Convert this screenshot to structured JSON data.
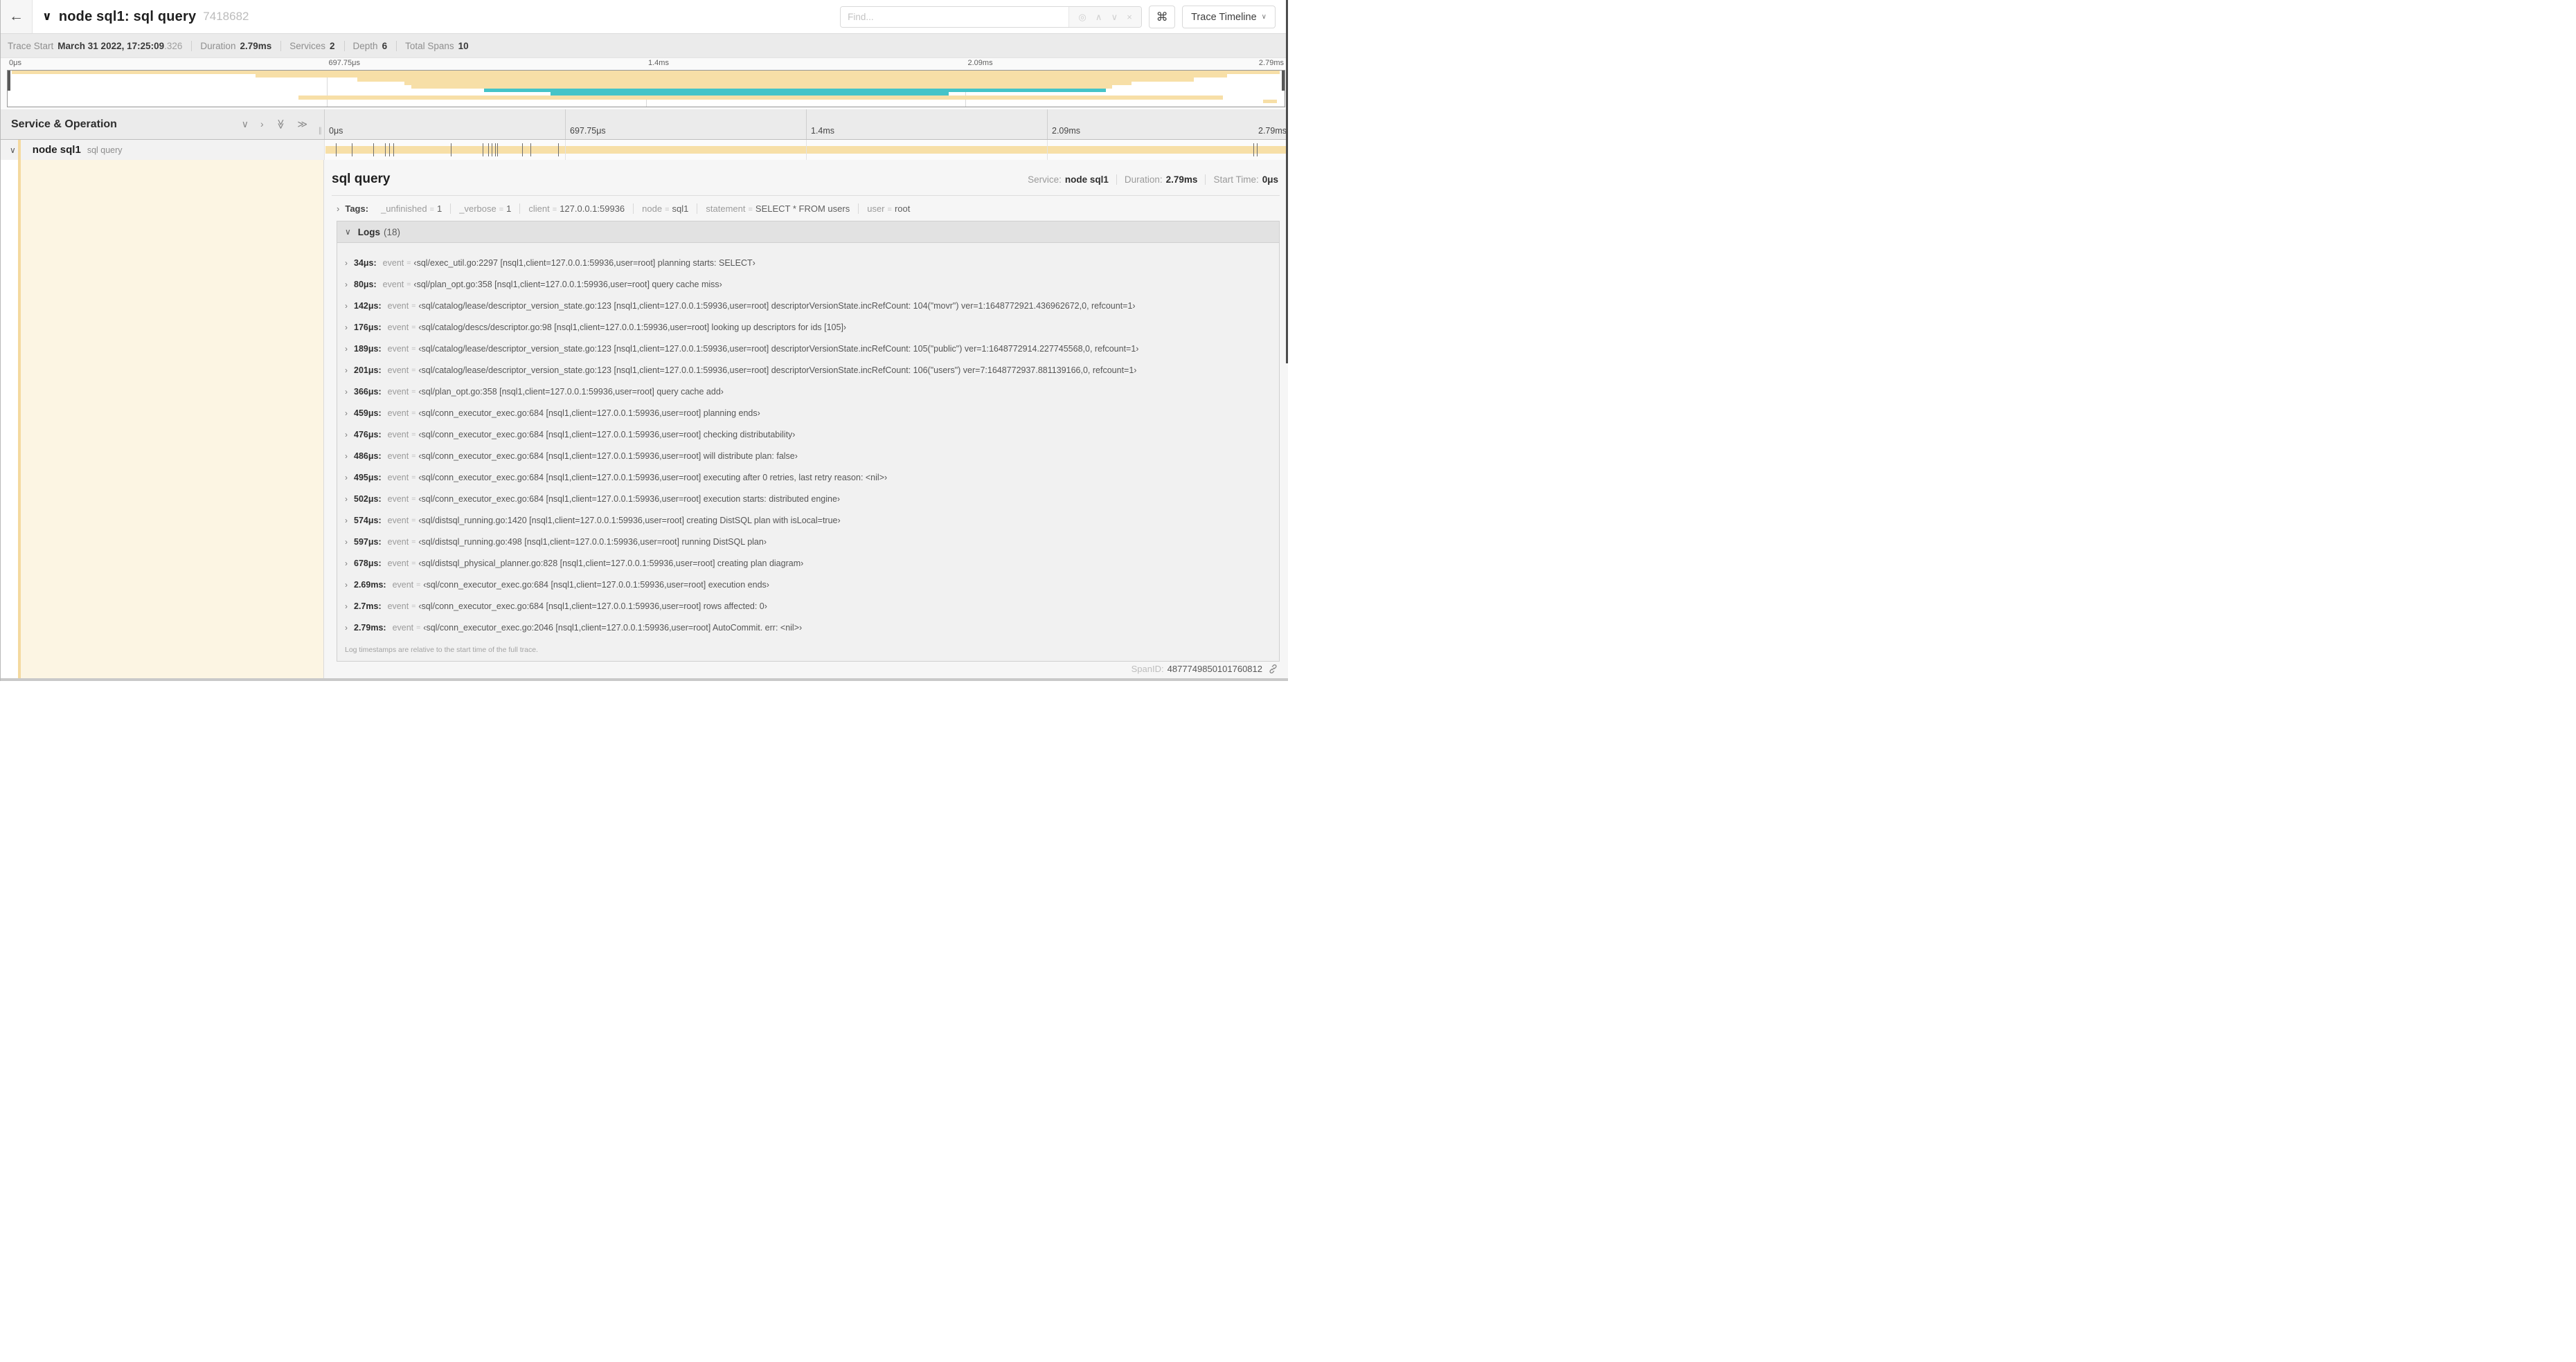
{
  "glyphs": {
    "back": "←",
    "chevron_down": "∨",
    "chevron_right": "›",
    "double_chevron_right": "≫",
    "target": "◎",
    "up": "∧",
    "down": "∨",
    "close": "×",
    "command": "⌘",
    "caret": "›",
    "eq": "=",
    "quote_open": "‹",
    "quote_close": "›",
    "grip": "∥"
  },
  "header": {
    "title": "node sql1: sql query",
    "trace_id": "7418682",
    "find_placeholder": "Find...",
    "shortcut_label": "⌘",
    "view_selector": "Trace Timeline"
  },
  "summary": {
    "items": [
      {
        "label": "Trace Start",
        "value": "March 31 2022, 17:25:09",
        "suffix": ".326"
      },
      {
        "label": "Duration",
        "value": "2.79ms"
      },
      {
        "label": "Services",
        "value": "2"
      },
      {
        "label": "Depth",
        "value": "6"
      },
      {
        "label": "Total Spans",
        "value": "10"
      }
    ]
  },
  "timeline": {
    "duration_us": 2790,
    "tick_labels": [
      "0μs",
      "697.75μs",
      "1.4ms",
      "2.09ms",
      "2.79ms"
    ],
    "tick_positions": [
      0,
      25,
      50,
      75,
      100
    ],
    "minimap_grid_positions": [
      25,
      50,
      75
    ],
    "main_grid_positions": [
      0,
      25,
      50,
      75
    ]
  },
  "minimap": {
    "rows": 10,
    "spans": [
      {
        "row": 0,
        "start_pct": 0.3,
        "end_pct": 99.6,
        "color": "tan"
      },
      {
        "row": 1,
        "start_pct": 19.4,
        "end_pct": 95.5,
        "color": "tan"
      },
      {
        "row": 2,
        "start_pct": 27.4,
        "end_pct": 92.9,
        "color": "tan"
      },
      {
        "row": 3,
        "start_pct": 31.1,
        "end_pct": 88.0,
        "color": "tan"
      },
      {
        "row": 4,
        "start_pct": 31.6,
        "end_pct": 86.5,
        "color": "tan"
      },
      {
        "row": 5,
        "start_pct": 37.3,
        "end_pct": 86.0,
        "color": "teal"
      },
      {
        "row": 6,
        "start_pct": 42.5,
        "end_pct": 73.7,
        "color": "teal"
      },
      {
        "row": 7,
        "start_pct": 22.8,
        "end_pct": 95.2,
        "color": "tan"
      },
      {
        "row": 8,
        "start_pct": 98.3,
        "end_pct": 99.4,
        "color": "tan"
      }
    ]
  },
  "timeline_header": {
    "title": "Service & Operation"
  },
  "span_row": {
    "service": "node sql1",
    "operation": "sql query"
  },
  "detail": {
    "title": "sql query",
    "meta": [
      {
        "label": "Service:",
        "value": "node sql1"
      },
      {
        "label": "Duration:",
        "value": "2.79ms"
      },
      {
        "label": "Start Time:",
        "value": "0μs"
      }
    ],
    "tags_label": "Tags:",
    "tags": [
      {
        "key": "_unfinished",
        "value": "1"
      },
      {
        "key": "_verbose",
        "value": "1"
      },
      {
        "key": "client",
        "value": "127.0.0.1:59936"
      },
      {
        "key": "node",
        "value": "sql1"
      },
      {
        "key": "statement",
        "value": "SELECT * FROM users"
      },
      {
        "key": "user",
        "value": "root"
      }
    ],
    "logs_label": "Logs",
    "logs_count": "(18)",
    "log_key": "event",
    "logs": [
      {
        "time_label": "34μs:",
        "us": 34,
        "value": "sql/exec_util.go:2297 [nsql1,client=127.0.0.1:59936,user=root] planning starts: SELECT"
      },
      {
        "time_label": "80μs:",
        "us": 80,
        "value": "sql/plan_opt.go:358 [nsql1,client=127.0.0.1:59936,user=root] query cache miss"
      },
      {
        "time_label": "142μs:",
        "us": 142,
        "value": "sql/catalog/lease/descriptor_version_state.go:123 [nsql1,client=127.0.0.1:59936,user=root] descriptorVersionState.incRefCount: 104(\"movr\") ver=1:1648772921.436962672,0, refcount=1"
      },
      {
        "time_label": "176μs:",
        "us": 176,
        "value": "sql/catalog/descs/descriptor.go:98 [nsql1,client=127.0.0.1:59936,user=root] looking up descriptors for ids [105]"
      },
      {
        "time_label": "189μs:",
        "us": 189,
        "value": "sql/catalog/lease/descriptor_version_state.go:123 [nsql1,client=127.0.0.1:59936,user=root] descriptorVersionState.incRefCount: 105(\"public\") ver=1:1648772914.227745568,0, refcount=1"
      },
      {
        "time_label": "201μs:",
        "us": 201,
        "value": "sql/catalog/lease/descriptor_version_state.go:123 [nsql1,client=127.0.0.1:59936,user=root] descriptorVersionState.incRefCount: 106(\"users\") ver=7:1648772937.881139166,0, refcount=1"
      },
      {
        "time_label": "366μs:",
        "us": 366,
        "value": "sql/plan_opt.go:358 [nsql1,client=127.0.0.1:59936,user=root] query cache add"
      },
      {
        "time_label": "459μs:",
        "us": 459,
        "value": "sql/conn_executor_exec.go:684 [nsql1,client=127.0.0.1:59936,user=root] planning ends"
      },
      {
        "time_label": "476μs:",
        "us": 476,
        "value": "sql/conn_executor_exec.go:684 [nsql1,client=127.0.0.1:59936,user=root] checking distributability"
      },
      {
        "time_label": "486μs:",
        "us": 486,
        "value": "sql/conn_executor_exec.go:684 [nsql1,client=127.0.0.1:59936,user=root] will distribute plan: false"
      },
      {
        "time_label": "495μs:",
        "us": 495,
        "value": "sql/conn_executor_exec.go:684 [nsql1,client=127.0.0.1:59936,user=root] executing after 0 retries, last retry reason: <nil>"
      },
      {
        "time_label": "502μs:",
        "us": 502,
        "value": "sql/conn_executor_exec.go:684 [nsql1,client=127.0.0.1:59936,user=root] execution starts: distributed engine"
      },
      {
        "time_label": "574μs:",
        "us": 574,
        "value": "sql/distsql_running.go:1420 [nsql1,client=127.0.0.1:59936,user=root] creating DistSQL plan with isLocal=true"
      },
      {
        "time_label": "597μs:",
        "us": 597,
        "value": "sql/distsql_running.go:498 [nsql1,client=127.0.0.1:59936,user=root] running DistSQL plan"
      },
      {
        "time_label": "678μs:",
        "us": 678,
        "value": "sql/distsql_physical_planner.go:828 [nsql1,client=127.0.0.1:59936,user=root] creating plan diagram"
      },
      {
        "time_label": "2.69ms:",
        "us": 2690,
        "value": "sql/conn_executor_exec.go:684 [nsql1,client=127.0.0.1:59936,user=root] execution ends"
      },
      {
        "time_label": "2.7ms:",
        "us": 2700,
        "value": "sql/conn_executor_exec.go:684 [nsql1,client=127.0.0.1:59936,user=root] rows affected: 0"
      },
      {
        "time_label": "2.79ms:",
        "us": 2790,
        "value": "sql/conn_executor_exec.go:2046 [nsql1,client=127.0.0.1:59936,user=root] AutoCommit. err: <nil>"
      }
    ],
    "logs_footnote": "Log timestamps are relative to the start time of the full trace.",
    "span_id_label": "SpanID:",
    "span_id": "4877749850101760812"
  },
  "colors": {
    "tan": "#f7dfa7",
    "teal": "#45c4c8",
    "cream": "#fcf5e3",
    "accent": "#f4d99f"
  }
}
